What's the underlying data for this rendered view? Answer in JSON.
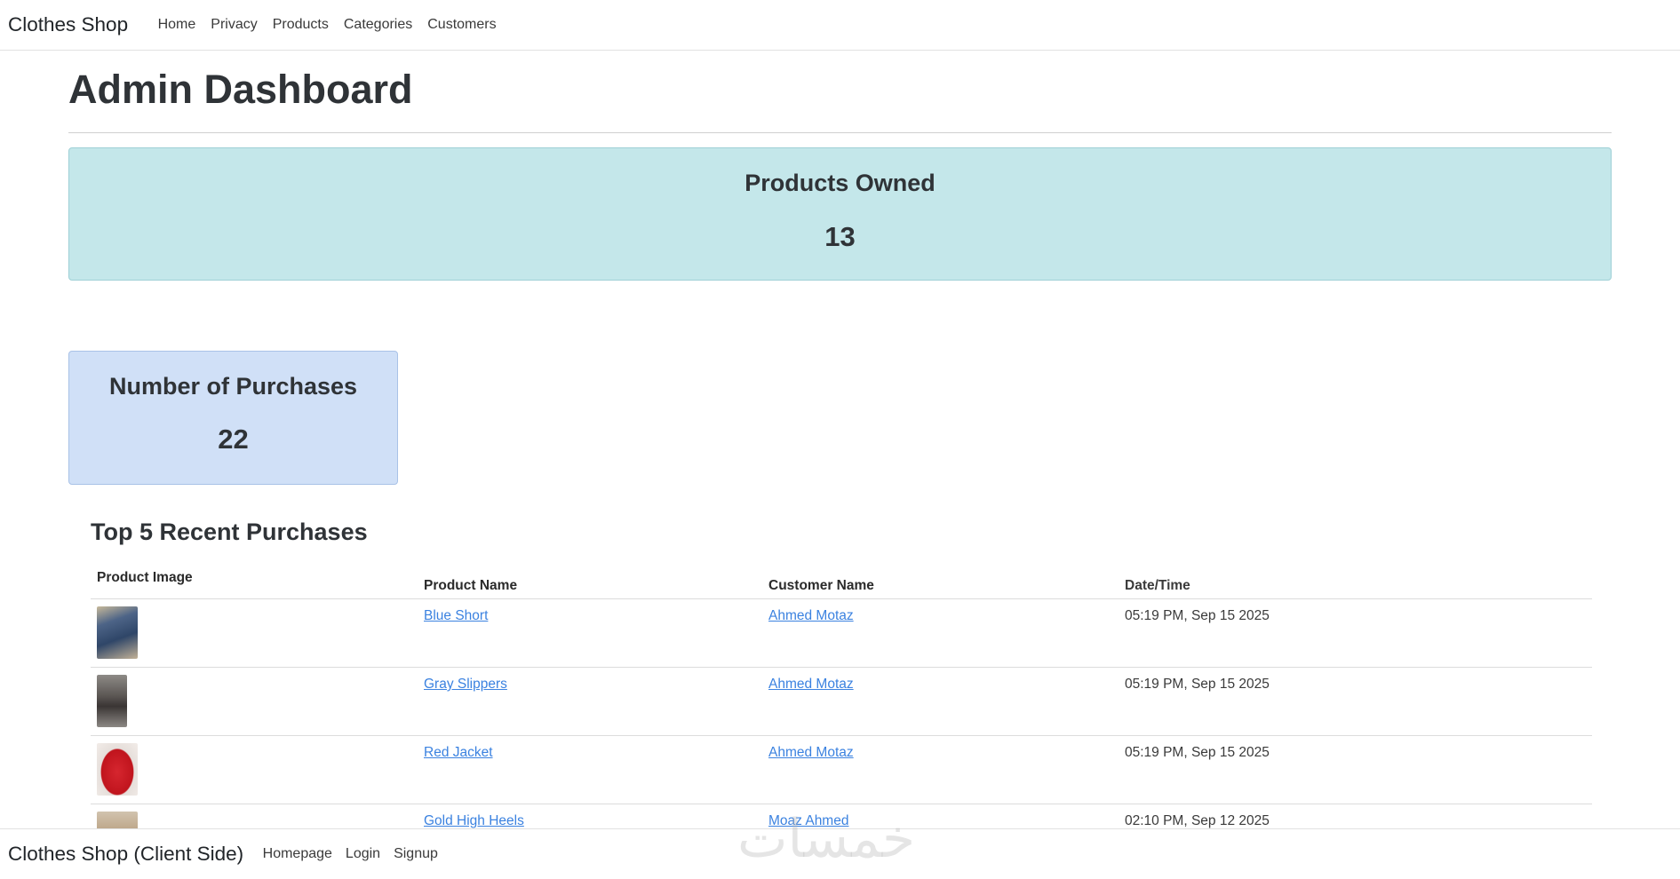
{
  "nav": {
    "brand": "Clothes Shop",
    "links": [
      "Home",
      "Privacy",
      "Products",
      "Categories",
      "Customers"
    ]
  },
  "main": {
    "title": "Admin Dashboard",
    "products_owned": {
      "label": "Products Owned",
      "value": "13"
    },
    "purchases": {
      "label": "Number of Purchases",
      "value": "22"
    },
    "recent": {
      "title": "Top 5 Recent Purchases",
      "headers": [
        "Product Image",
        "Product Name",
        "Customer Name",
        "Date/Time"
      ],
      "rows": [
        {
          "image": "blue-short-image",
          "product": "Blue Short",
          "customer": "Ahmed Motaz",
          "datetime": "05:19 PM, Sep 15 2025"
        },
        {
          "image": "gray-slippers-image",
          "product": "Gray Slippers",
          "customer": "Ahmed Motaz",
          "datetime": "05:19 PM, Sep 15 2025"
        },
        {
          "image": "red-jacket-image",
          "product": "Red Jacket",
          "customer": "Ahmed Motaz",
          "datetime": "05:19 PM, Sep 15 2025"
        },
        {
          "image": "gold-high-heels-image",
          "product": "Gold High Heels",
          "customer": "Moaz Ahmed",
          "datetime": "02:10 PM, Sep 12 2025"
        }
      ]
    }
  },
  "footer": {
    "brand": "Clothes Shop (Client Side)",
    "links": [
      "Homepage",
      "Login",
      "Signup"
    ]
  },
  "watermark": "خمسات"
}
